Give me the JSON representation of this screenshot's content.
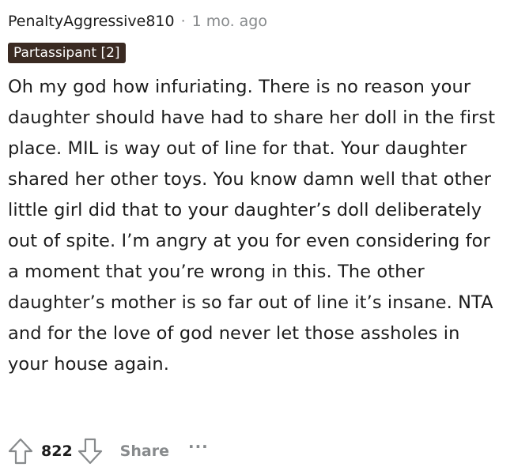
{
  "comment": {
    "author": "PenaltyAggressive810",
    "separator": "·",
    "age": "1 mo. ago",
    "flair": "Partassipant [2]",
    "body": "Oh my god how infuriating. There is no reason your daughter should have had to share her doll in the first place. MIL is way out of line for that. Your daughter shared her other toys. You know damn well that other little girl did that to your daughter’s doll deliberately out of spite. I’m angry at you for even considering for a moment that you’re wrong in this. The other daughter’s mother is so far out of line it’s insane. NTA and for the love of god never let those assholes in your house again."
  },
  "actions": {
    "upvote_icon": "upvote-arrow-icon",
    "score": "822",
    "downvote_icon": "downvote-arrow-icon",
    "share_label": "Share",
    "more_label": "···"
  },
  "colors": {
    "text": "#1c1c1c",
    "muted": "#878a8c",
    "flair_bg": "#3a2a22",
    "flair_text": "#ffffff"
  }
}
